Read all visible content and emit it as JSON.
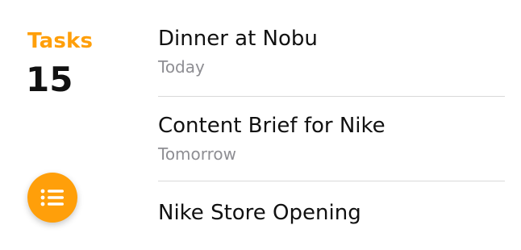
{
  "summary": {
    "title": "Tasks",
    "count": "15"
  },
  "fab": {
    "icon": "list-icon"
  },
  "tasks": [
    {
      "title": "Dinner at Nobu",
      "due": "Today"
    },
    {
      "title": "Content Brief for Nike",
      "due": "Tomorrow"
    },
    {
      "title": "Nike Store Opening",
      "due": ""
    }
  ],
  "colors": {
    "accent": "#FF9F0A",
    "title_text": "#111111",
    "secondary_text": "#8E8E93",
    "divider": "#D9D9D9"
  }
}
